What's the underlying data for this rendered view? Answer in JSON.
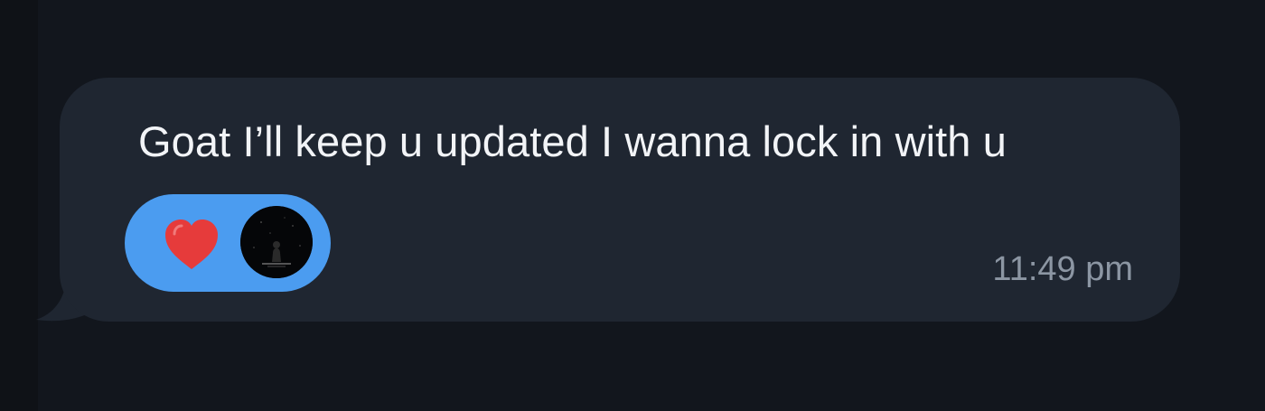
{
  "message": {
    "text": "Goat I’ll keep u updated I wanna lock in with u",
    "timestamp": "11:49 pm",
    "reactions": [
      {
        "emoji": "heart",
        "reactor_avatar_icon": "avatar-icon"
      }
    ]
  },
  "colors": {
    "background": "#12161d",
    "bubble": "#1f2631",
    "reaction_pill": "#4b9cf0",
    "heart": "#e63b3b",
    "text": "#f2f4f7",
    "timestamp": "#8c96a3"
  }
}
